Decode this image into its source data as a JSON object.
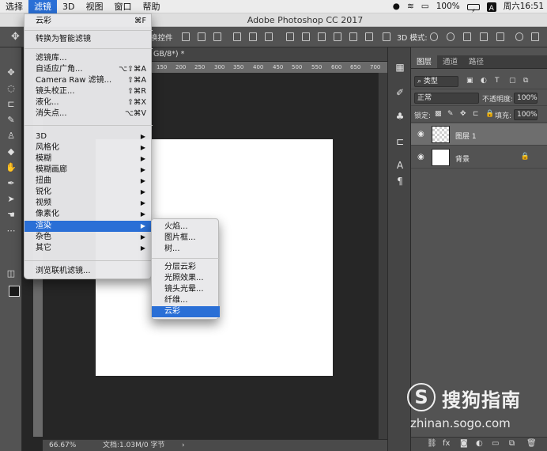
{
  "menubar": {
    "items": [
      "选择",
      "滤镜",
      "3D",
      "视图",
      "窗口",
      "帮助"
    ],
    "battery": "100%",
    "battery_icon": "⚡",
    "input_method": "A",
    "clock": "周六16:51"
  },
  "window": {
    "title": "Adobe Photoshop CC 2017"
  },
  "optionsbar": {
    "transform_controls": "换控件",
    "mode_3d": "3D 模式:"
  },
  "document": {
    "tab_label": "GB/8*) *",
    "ruler_ticks": [
      "150",
      "200",
      "250",
      "300",
      "350",
      "400",
      "450",
      "500",
      "550",
      "600",
      "650",
      "700"
    ],
    "zoom": "66.67%",
    "doc_info": "文档:1.03M/0 字节"
  },
  "filter_menu": {
    "last_filter": {
      "label": "云彩",
      "shortcut": "⌘F"
    },
    "convert_smart": "转换为智能滤镜",
    "group2": [
      {
        "label": "滤镜库...",
        "shortcut": ""
      },
      {
        "label": "自适应广角...",
        "shortcut": "⌥⇧⌘A"
      },
      {
        "label": "Camera Raw 滤镜...",
        "shortcut": "⇧⌘A"
      },
      {
        "label": "镜头校正...",
        "shortcut": "⇧⌘R"
      },
      {
        "label": "液化...",
        "shortcut": "⇧⌘X"
      },
      {
        "label": "消失点...",
        "shortcut": "⌥⌘V"
      }
    ],
    "group3": [
      "3D",
      "风格化",
      "模糊",
      "模糊画廊",
      "扭曲",
      "锐化",
      "视频",
      "像素化",
      "渲染",
      "杂色",
      "其它"
    ],
    "highlighted": "渲染",
    "browse_online": "浏览联机滤镜..."
  },
  "render_submenu": {
    "group1": [
      "火焰...",
      "图片框...",
      "树..."
    ],
    "group2": [
      "分层云彩",
      "光照效果...",
      "镜头光晕...",
      "纤维...",
      "云彩"
    ],
    "highlighted": "云彩"
  },
  "layers_panel": {
    "tabs": [
      "图层",
      "通道",
      "路径"
    ],
    "filter_kind": "类型",
    "blend_mode": "正常",
    "opacity_label": "不透明度:",
    "opacity_value": "100%",
    "lock_label": "锁定:",
    "fill_label": "填充:",
    "fill_value": "100%",
    "layers": [
      {
        "name": "图层 1",
        "selected": true
      },
      {
        "name": "背景",
        "selected": false
      }
    ]
  },
  "watermark": {
    "title": "搜狗指南",
    "url": "zhinan.sogo.com"
  },
  "colors": {
    "accent": "#2a6fd6",
    "panel": "#535353",
    "canvas": "#ffffff"
  }
}
